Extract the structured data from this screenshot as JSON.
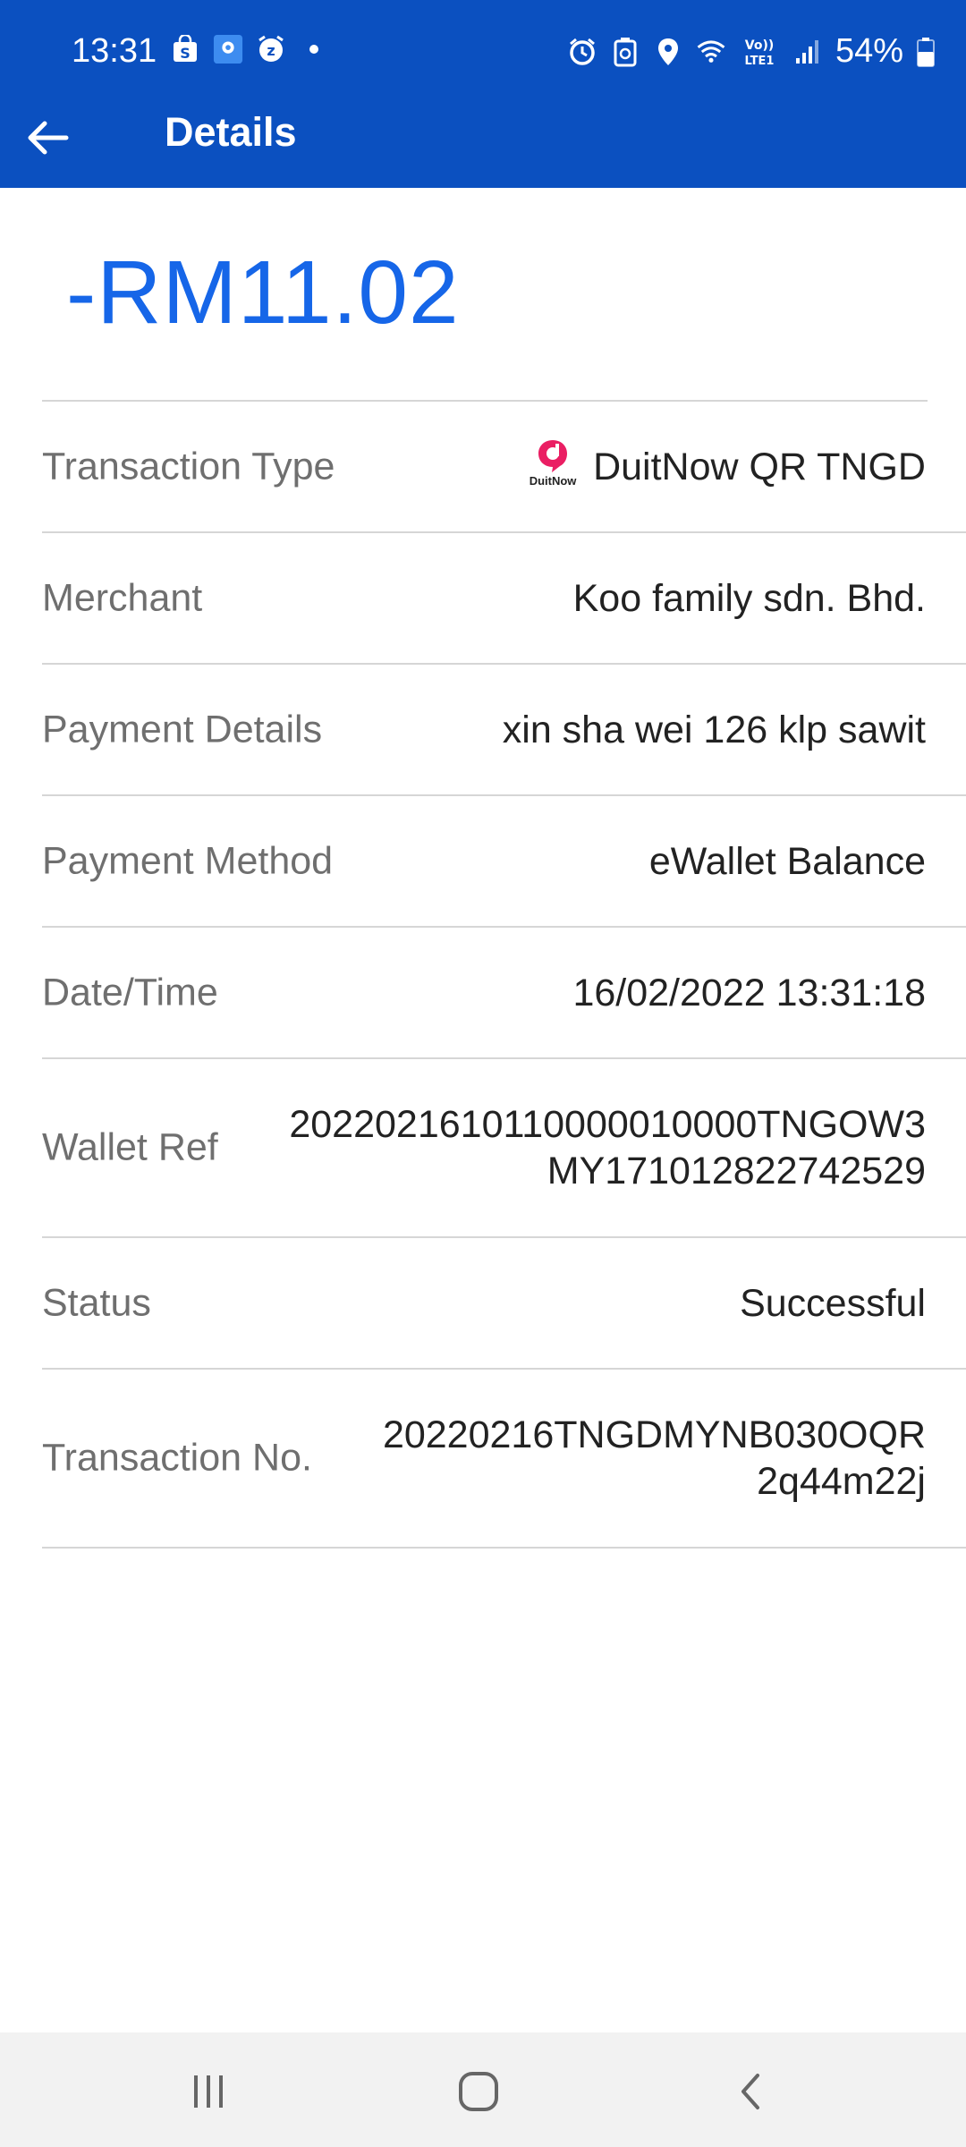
{
  "status_bar": {
    "time": "13:31",
    "battery": "54%",
    "left_icons": [
      "shopee-icon",
      "maps-app-icon",
      "alarm-snooze-icon",
      "dot-icon"
    ],
    "right_icons": [
      "alarm-icon",
      "recycle-battery-icon",
      "location-icon",
      "wifi-icon",
      "volte-icon",
      "signal-icon",
      "battery-icon"
    ]
  },
  "app_bar": {
    "title": "Details",
    "back_icon": "arrow-left-icon"
  },
  "amount": "-RM11.02",
  "accent_color": "#1666e8",
  "header_color": "#0b50c0",
  "details": [
    {
      "label": "Transaction Type",
      "value": "DuitNow QR TNGD",
      "logo_text": "DuitNow"
    },
    {
      "label": "Merchant",
      "value": "Koo family sdn. Bhd."
    },
    {
      "label": "Payment Details",
      "value": "xin sha wei 126 klp sawit"
    },
    {
      "label": "Payment Method",
      "value": "eWallet Balance"
    },
    {
      "label": "Date/Time",
      "value": "16/02/2022 13:31:18"
    },
    {
      "label": "Wallet Ref",
      "value_line1": "20220216101100000100​00TNGOW3",
      "value_line2": "MY171012822742529"
    },
    {
      "label": "Status",
      "value": "Successful"
    },
    {
      "label": "Transaction No.",
      "value_line1": "20220216TNGDMYNB030OQR",
      "value_line2": "2q44m22j"
    }
  ],
  "nav_bar": {
    "recents_icon": "recents-icon",
    "home_icon": "home-icon",
    "back_icon": "nav-back-icon"
  }
}
